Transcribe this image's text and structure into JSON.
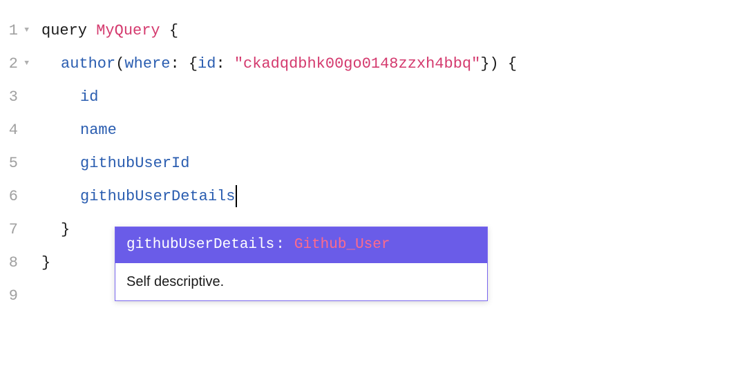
{
  "lines": {
    "count": 9,
    "foldable": [
      1,
      2
    ]
  },
  "code": {
    "l1": {
      "keyword": "query",
      "name": "MyQuery",
      "open": " {"
    },
    "l2": {
      "field": "author",
      "open_paren": "(",
      "arg": "where",
      "colon": ":",
      "inner_open": " {",
      "inner_arg": "id",
      "inner_colon": ":",
      "string": "\"ckadqdbhk00go0148zzxh4bbq\"",
      "inner_close": "}",
      "close_paren": ")",
      "open": " {"
    },
    "l3": {
      "field": "id"
    },
    "l4": {
      "field": "name"
    },
    "l5": {
      "field": "githubUserId"
    },
    "l6": {
      "field": "githubUserDetails"
    },
    "l7": {
      "close": "}"
    },
    "l8": {
      "close": "}"
    }
  },
  "autocomplete": {
    "item_name": "githubUserDetails",
    "item_colon": ":",
    "item_type": "Github_User",
    "description": "Self descriptive."
  },
  "colors": {
    "keyword": "#1a1a1a",
    "identifier": "#d43a6e",
    "field": "#2a5db0",
    "string": "#d43a6e",
    "popup_bg": "#6a5ce8",
    "popup_type": "#ff6b8a"
  }
}
